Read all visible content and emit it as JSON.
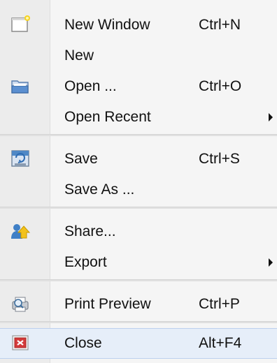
{
  "menu": {
    "items": [
      {
        "label": "New Window",
        "shortcut": "Ctrl+N",
        "icon": "new-window-icon"
      },
      {
        "label": "New",
        "shortcut": ""
      },
      {
        "label": "Open ...",
        "shortcut": "Ctrl+O",
        "icon": "open-folder-icon"
      },
      {
        "label": "Open Recent",
        "shortcut": "",
        "submenu": true
      },
      {
        "label": "Save",
        "shortcut": "Ctrl+S",
        "icon": "save-icon"
      },
      {
        "label": "Save As ...",
        "shortcut": ""
      },
      {
        "label": "Share...",
        "shortcut": "",
        "icon": "share-icon"
      },
      {
        "label": "Export",
        "shortcut": "",
        "submenu": true
      },
      {
        "label": "Print Preview",
        "shortcut": "Ctrl+P",
        "icon": "print-preview-icon"
      },
      {
        "label": "Close",
        "shortcut": "Alt+F4",
        "icon": "close-icon",
        "highlighted": true
      }
    ]
  },
  "colors": {
    "highlight_bg": "#e6eef9",
    "close_icon_red": "#d33a3a",
    "folder_blue": "#5b8fd0",
    "share_arrow_yellow": "#f2c21b"
  }
}
